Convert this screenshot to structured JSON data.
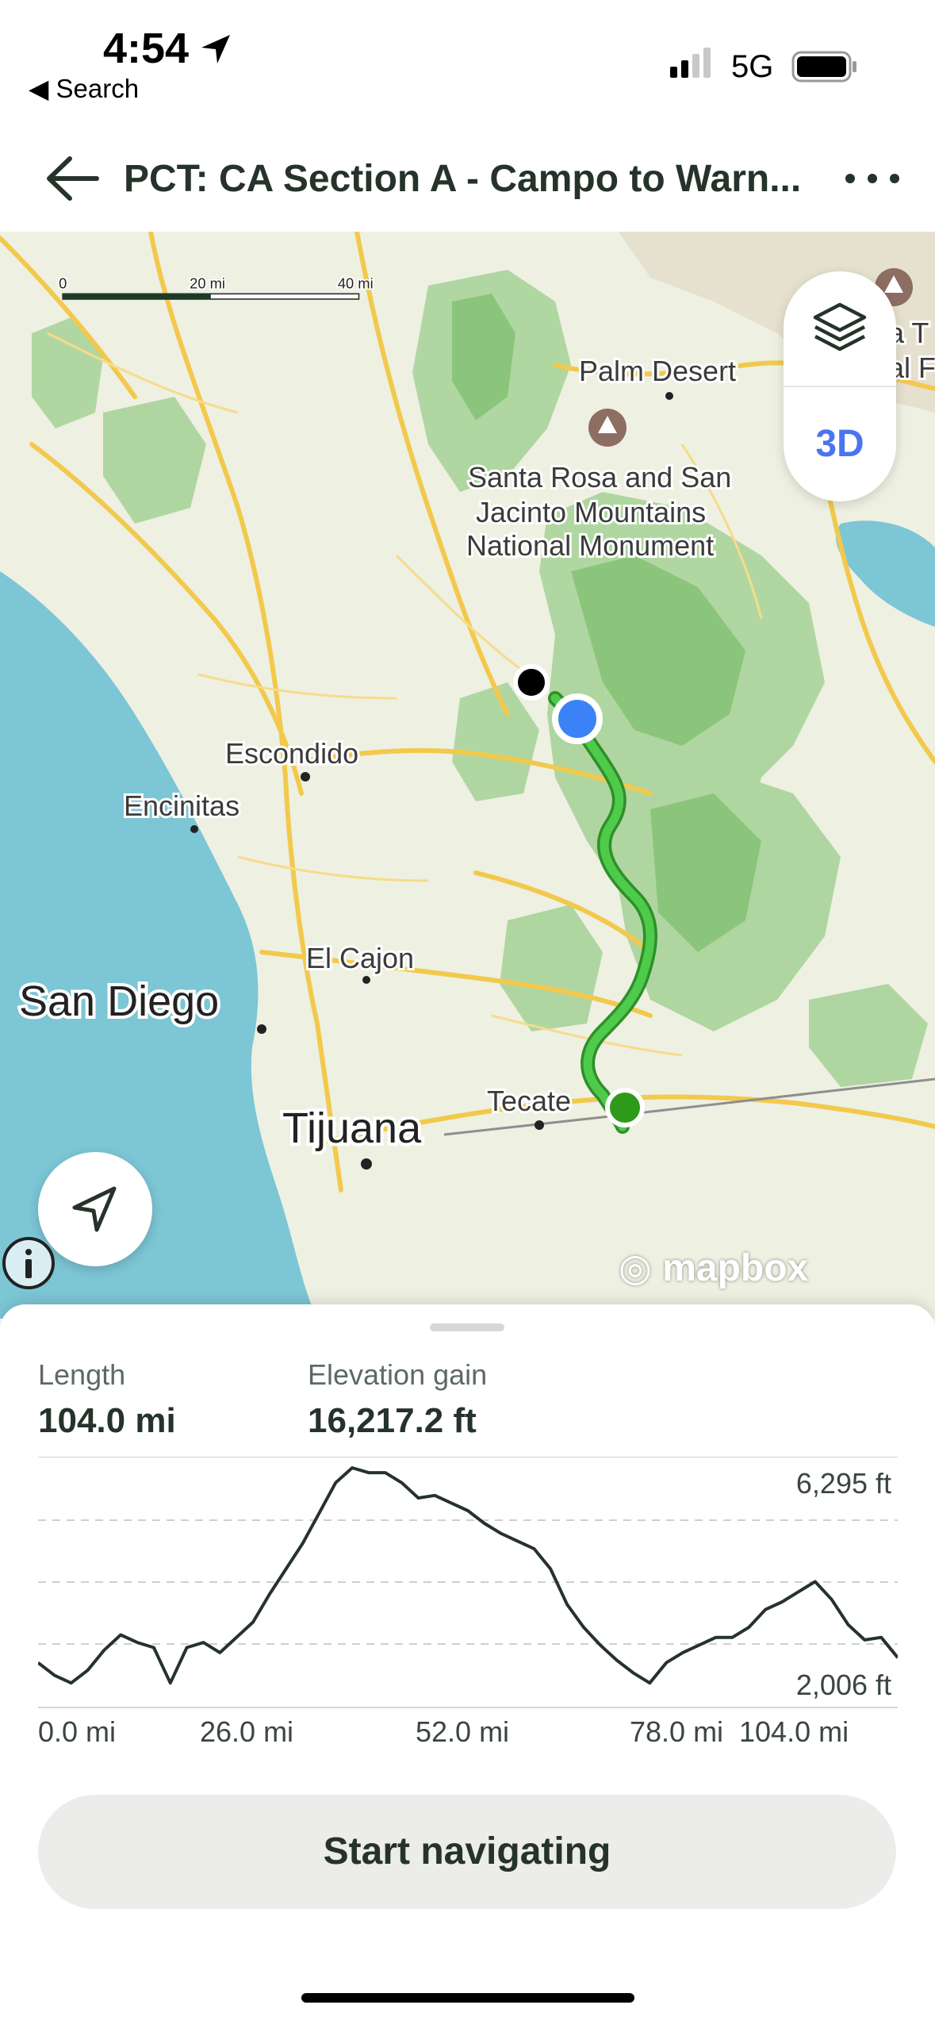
{
  "status_bar": {
    "time": "4:54",
    "back_app": "◀ Search",
    "network": "5G"
  },
  "header": {
    "title": "PCT: CA Section A - Campo to Warn..."
  },
  "map": {
    "scale": {
      "tick0": "0",
      "tick1": "20 mi",
      "tick2": "40 mi"
    },
    "layers_3d_label": "3D",
    "labels": {
      "palm_desert": "Palm Desert",
      "monument_1": "Santa Rosa and San",
      "monument_2": "Jacinto Mountains",
      "monument_3": "National Monument",
      "escondido": "Escondido",
      "encinitas": "Encinitas",
      "el_cajon": "El Cajon",
      "san_diego": "San Diego",
      "tecate": "Tecate",
      "tijuana": "Tijuana",
      "edge_1": "a T",
      "edge_2": "al F"
    },
    "attribution": "mapbox",
    "colors": {
      "trail": "#4ecb4a",
      "water": "#7cc6d6",
      "start": "#2e9a1a",
      "current": "#3b82f6"
    }
  },
  "stats": {
    "length_label": "Length",
    "length_value": "104.0 mi",
    "gain_label": "Elevation gain",
    "gain_value": "16,217.2 ft"
  },
  "chart_data": {
    "type": "line",
    "title": "",
    "xlabel": "",
    "ylabel": "",
    "x_ticks": [
      "0.0 mi",
      "26.0 mi",
      "52.0 mi",
      "78.0 mi",
      "104.0 mi"
    ],
    "y_labels": {
      "max": "6,295 ft",
      "min": "2,006 ft"
    },
    "ylim": [
      2006,
      6295
    ],
    "xlim": [
      0,
      104
    ],
    "series": [
      {
        "x": [
          0,
          2,
          4,
          6,
          8,
          10,
          12,
          14,
          16,
          18,
          20,
          22,
          24,
          26,
          28,
          30,
          32,
          34,
          36,
          38,
          40,
          42,
          44,
          46,
          48,
          50,
          52,
          54,
          56,
          58,
          60,
          62,
          64,
          66,
          68,
          70,
          72,
          74,
          76,
          78,
          80,
          82,
          84,
          86,
          88,
          90,
          92,
          94,
          96,
          98,
          100,
          102,
          104
        ],
        "values": [
          2450,
          2200,
          2050,
          2300,
          2700,
          3000,
          2850,
          2750,
          2050,
          2750,
          2850,
          2650,
          2950,
          3250,
          3800,
          4300,
          4800,
          5400,
          6000,
          6295,
          6200,
          6200,
          6000,
          5700,
          5750,
          5600,
          5450,
          5200,
          5000,
          4850,
          4700,
          4300,
          3600,
          3150,
          2800,
          2500,
          2250,
          2050,
          2450,
          2650,
          2800,
          2950,
          2950,
          3150,
          3500,
          3650,
          3850,
          4050,
          3700,
          3200,
          2900,
          2950,
          2550
        ]
      }
    ],
    "grid": true
  },
  "actions": {
    "start": "Start navigating"
  }
}
